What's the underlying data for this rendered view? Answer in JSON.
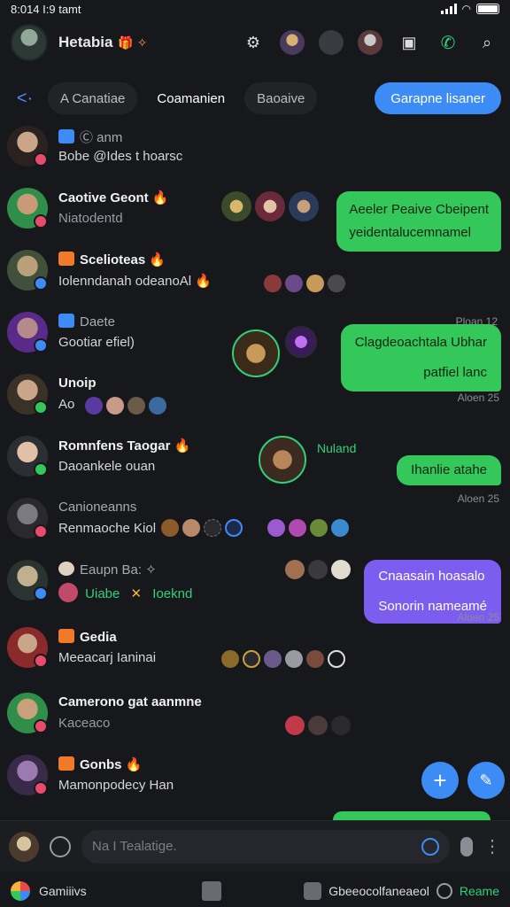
{
  "status": {
    "time": "8:014 I:9 tamt"
  },
  "header": {
    "title": "Hetabia",
    "emoji": "🎁 ✧"
  },
  "tabs": [
    {
      "label": "A Canatiae"
    },
    {
      "label": "Coamanien"
    },
    {
      "label": "Baoaive"
    },
    {
      "label": "Garapne lisaner"
    }
  ],
  "rows": [
    {
      "name": "Ⓒ anm",
      "preview": "Bobe @Ides t hoarsc"
    },
    {
      "name": "Caotive Geont 🔥",
      "preview": "Niatodentd",
      "bubble": [
        "Aeeler Peaive Cbeipent",
        "yeidentalucemnamel"
      ],
      "time": "Ploan 12"
    },
    {
      "name": "Scelioteas 🔥",
      "preview": "Iolenndanah odeanoAl 🔥"
    },
    {
      "name": "Daete",
      "preview": "Gootiar efiel)",
      "bubble": [
        "Clagdeoachtala Ubhar",
        "patfiel lanc"
      ],
      "time": "Aloen 25"
    },
    {
      "name": "Unoip",
      "preview": "Ao"
    },
    {
      "name": "Romnfens Taogar 🔥",
      "preview": "Daoankele ouan",
      "label": "Nuland",
      "bubble": [
        "Ihanlie atahe"
      ],
      "time": "Aloen 25"
    },
    {
      "name": "Canioneanns",
      "preview": "Renmaoche Kiol"
    },
    {
      "name": "Eaupn Ba: ✧",
      "preview_a": "Uiabe",
      "preview_b": "Ioeknd",
      "bubble": [
        "Cnaasain hoasalo",
        "Sonorin nameamé"
      ],
      "time": "Aloen 25"
    },
    {
      "name": "Gedia",
      "preview": "Meeacarj Ianinai"
    },
    {
      "name": "Camerono gat aanmne",
      "preview": "Kaceaco"
    },
    {
      "name": "Gonbs 🔥",
      "preview": "Mamonpodecy Han"
    }
  ],
  "composer": {
    "placeholder": "Na I Tealatige."
  },
  "bottomnav": {
    "left": "Gamiiivs",
    "right": "Gbeeocolfaneaeol",
    "right_green": "Reame"
  }
}
